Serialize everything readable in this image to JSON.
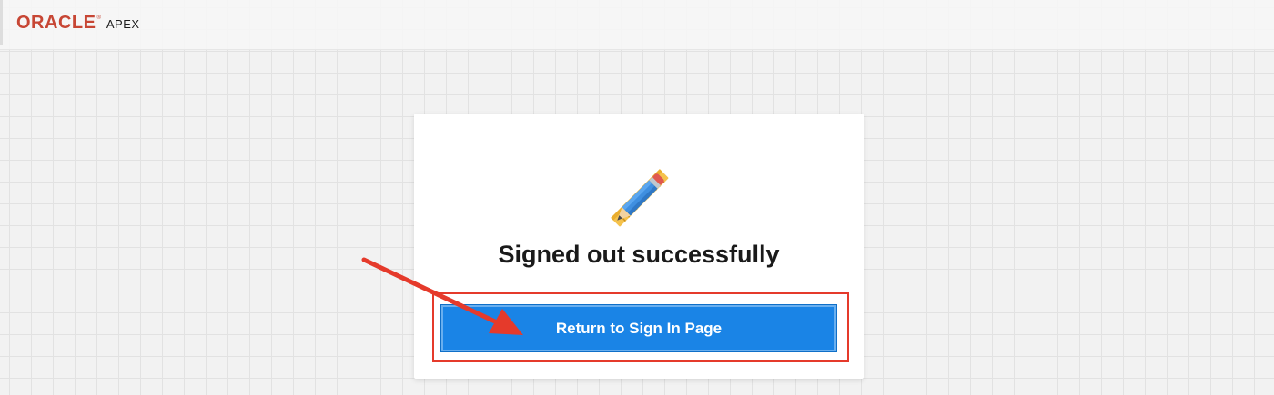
{
  "header": {
    "brand": "ORACLE",
    "registered_mark": "®",
    "product": "APEX"
  },
  "signout_card": {
    "illustration_icon": "pencil-ruler-icon",
    "title": "Signed out successfully",
    "return_button_label": "Return to Sign In Page"
  },
  "annotation": {
    "highlight_color": "#e53a2b",
    "arrow_color": "#e53a2b"
  },
  "colors": {
    "brand_red": "#c74634",
    "button_blue": "#1a84e6"
  }
}
